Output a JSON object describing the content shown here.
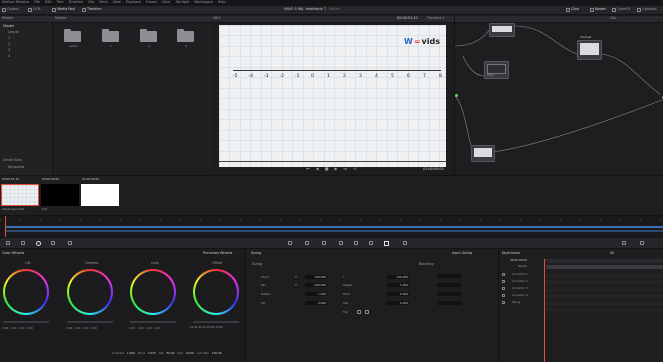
{
  "menu": [
    "DaVinci Resolve",
    "File",
    "Edit",
    "Trim",
    "Timeline",
    "Clip",
    "Mark",
    "View",
    "Playback",
    "Fusion",
    "Color",
    "Fairlight",
    "Workspace",
    "Help"
  ],
  "toolbar": {
    "gallery": "Gallery",
    "luts": "LUTs",
    "media_pool": "Media Pool",
    "timeline": "Timeline",
    "project_title": "HAVO 5 WA, Hoofdstuk 7",
    "edited": "Edited",
    "clips": "Clips",
    "nodes": "Nodes",
    "openfx": "OpenFX",
    "lightbox": "Lightbox"
  },
  "media_pool": {
    "header": "Master",
    "tree_root": "Master",
    "tree_items": [
      "Lesvid",
      "1",
      "2",
      "3",
      "4"
    ],
    "smart_bins": "Smart Bins",
    "keywords": "Keywords",
    "folders": [
      "Lesvid",
      "1",
      "2",
      "3"
    ]
  },
  "viewer": {
    "zoom": "48%",
    "timecode_top": "00:00:51:10",
    "clip_name": "Timeline 1",
    "timecode_bottom": "01:00:00:00",
    "number_line": [
      "-5",
      "-4",
      "-3",
      "-2",
      "-1",
      "0",
      "1",
      "2",
      "3",
      "4",
      "5",
      "6",
      "7",
      "8"
    ],
    "logo_left": "W",
    "logo_eq": "=",
    "logo_right": "vids"
  },
  "node_editor": {
    "header": "Clip",
    "nodes": [
      {
        "id": "01",
        "label": ""
      },
      {
        "id": "02",
        "label": "Node"
      },
      {
        "id": "03",
        "label": "Contrast"
      },
      {
        "id": "04",
        "label": ""
      }
    ]
  },
  "clips_strip": {
    "clips": [
      {
        "tc": "00:00:51:10",
        "num": "01",
        "name": "Wasknijpje RAW"
      },
      {
        "tc": "00:00:00:00",
        "num": "02",
        "name": "Clip"
      },
      {
        "tc": "01:00:00:00",
        "num": "03",
        "name": ""
      }
    ]
  },
  "color_wheels": {
    "title": "Color Wheels",
    "mode": "Primaries Wheels",
    "wheels": [
      {
        "name": "Lift",
        "values": [
          "0.00",
          "0.00",
          "0.00",
          "0.00"
        ]
      },
      {
        "name": "Gamma",
        "values": [
          "0.00",
          "0.00",
          "0.00",
          "0.00"
        ]
      },
      {
        "name": "Gain",
        "values": [
          "1.00",
          "1.00",
          "1.00",
          "1.00"
        ]
      },
      {
        "name": "Offset",
        "values": [
          "25.00",
          "25.00",
          "25.00",
          "25.00"
        ]
      }
    ],
    "footer": {
      "contrast_label": "Contrast",
      "contrast": "1.000",
      "pivot_label": "Pivot",
      "pivot": "0.435",
      "sat_label": "Sat",
      "sat": "50.00",
      "hue_label": "Hue",
      "hue": "50.00",
      "lum_mix_label": "Lum Mix",
      "lum_mix": "100.00"
    }
  },
  "sizing": {
    "title": "Sizing",
    "subtitle": "Sizing",
    "rows": [
      {
        "label": "Zoom",
        "x": "X",
        "x_val": "100.000",
        "y": "Y",
        "y_val": "100.000"
      },
      {
        "label": "Pan",
        "x": "X",
        "x_val": "-100.000",
        "y": "Height",
        "y_val": "1.000"
      },
      {
        "label": "Rotate",
        "x": "",
        "x_val": "1.000",
        "y": "Pitch",
        "y_val": "0.000"
      },
      {
        "label": "Tilt",
        "x": "",
        "x_val": "0.000",
        "y": "Yaw",
        "y_val": "0.000"
      }
    ],
    "flip": "Flip",
    "blanking": "Blanking",
    "input_sizing": "Input Sizing"
  },
  "keyframes": {
    "title": "Keyframes",
    "mode": "All",
    "timecode": "00:00:00:00",
    "master": "Master",
    "rows": [
      "Corrector 1",
      "Corrector 2",
      "Corrector 3",
      "Corrector 4",
      "Sizing"
    ]
  },
  "colors": {
    "accent": "#e0503c",
    "ruler": "#3a6fb0",
    "playhead": "#e0503c"
  }
}
